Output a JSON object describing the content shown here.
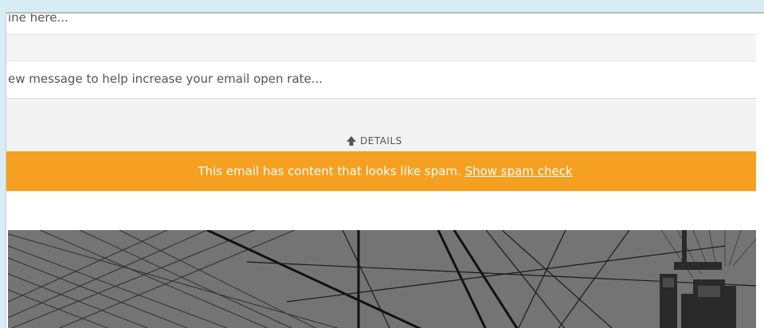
{
  "editor": {
    "subject_placeholder": "ine here...",
    "preview_placeholder": "ew message to help increase your email open rate...",
    "details_label": "DETAILS",
    "details_icon": "arrow-up-icon"
  },
  "spam_banner": {
    "message": "This email has content that looks like spam.",
    "link_label": "Show spam check",
    "color": "#f5a020"
  },
  "hero": {
    "icon": "bridge-cables-image"
  }
}
